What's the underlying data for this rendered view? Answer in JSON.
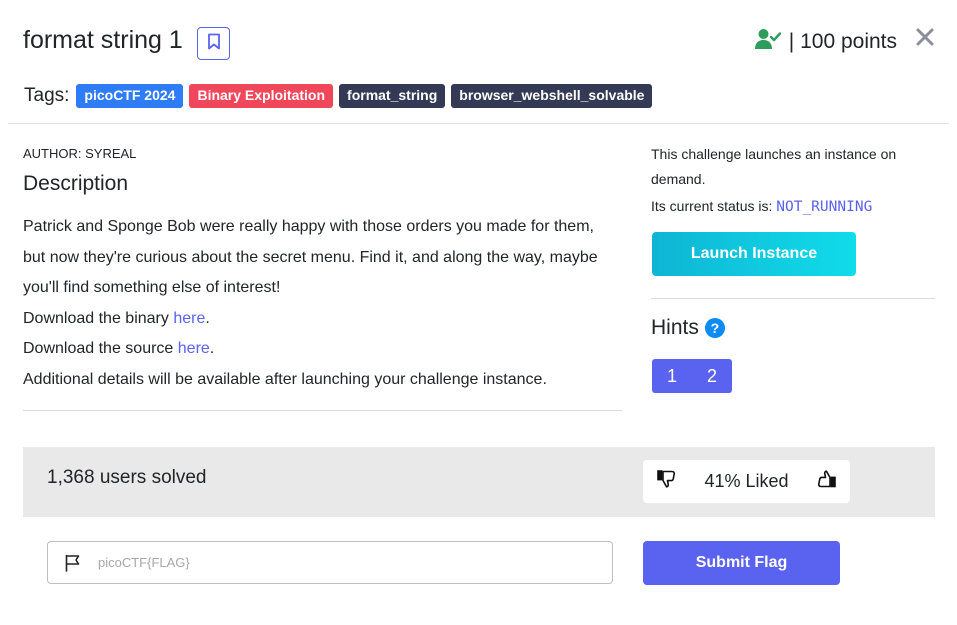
{
  "challenge": {
    "title": "format string 1",
    "points_text": "| 100 points"
  },
  "tags": {
    "label": "Tags:",
    "items": [
      {
        "label": "picoCTF 2024",
        "color": "#2e7cf6"
      },
      {
        "label": "Binary Exploitation",
        "color": "#f0475a"
      },
      {
        "label": "format_string",
        "color": "#343a55"
      },
      {
        "label": "browser_webshell_solvable",
        "color": "#343a55"
      }
    ]
  },
  "author": "AUTHOR: SYREAL",
  "description": {
    "heading": "Description",
    "paragraph": "Patrick and Sponge Bob were really happy with those orders you made for them, but now they're curious about the secret menu. Find it, and along the way, maybe you'll find something else of interest!",
    "binary_prefix": "Download the binary ",
    "binary_link": "here",
    "source_prefix": "Download the source ",
    "source_link": "here",
    "period": ".",
    "additional": "Additional details will be available after launching your challenge instance."
  },
  "instance": {
    "info": "This challenge launches an instance on demand.",
    "status_label": "Its current status is: ",
    "status_value": "NOT_RUNNING",
    "launch_label": "Launch Instance"
  },
  "hints": {
    "heading": "Hints",
    "help_glyph": "?",
    "items": [
      "1",
      "2"
    ]
  },
  "stats": {
    "solved_text": "1,368 users solved",
    "liked_text": "41% Liked"
  },
  "flag_form": {
    "placeholder": "picoCTF{FLAG}",
    "submit_label": "Submit Flag"
  },
  "icons": {
    "bookmark": "bookmark-icon",
    "user_check": "user-check-icon",
    "close": "close-icon",
    "thumbs_down": "thumbs-down-icon",
    "thumbs_up": "thumbs-up-icon",
    "flag": "flag-icon"
  },
  "colors": {
    "accent": "#5a62f0",
    "solved_green": "#2e9d5b",
    "launch_gradient": "#0fb5d4"
  }
}
